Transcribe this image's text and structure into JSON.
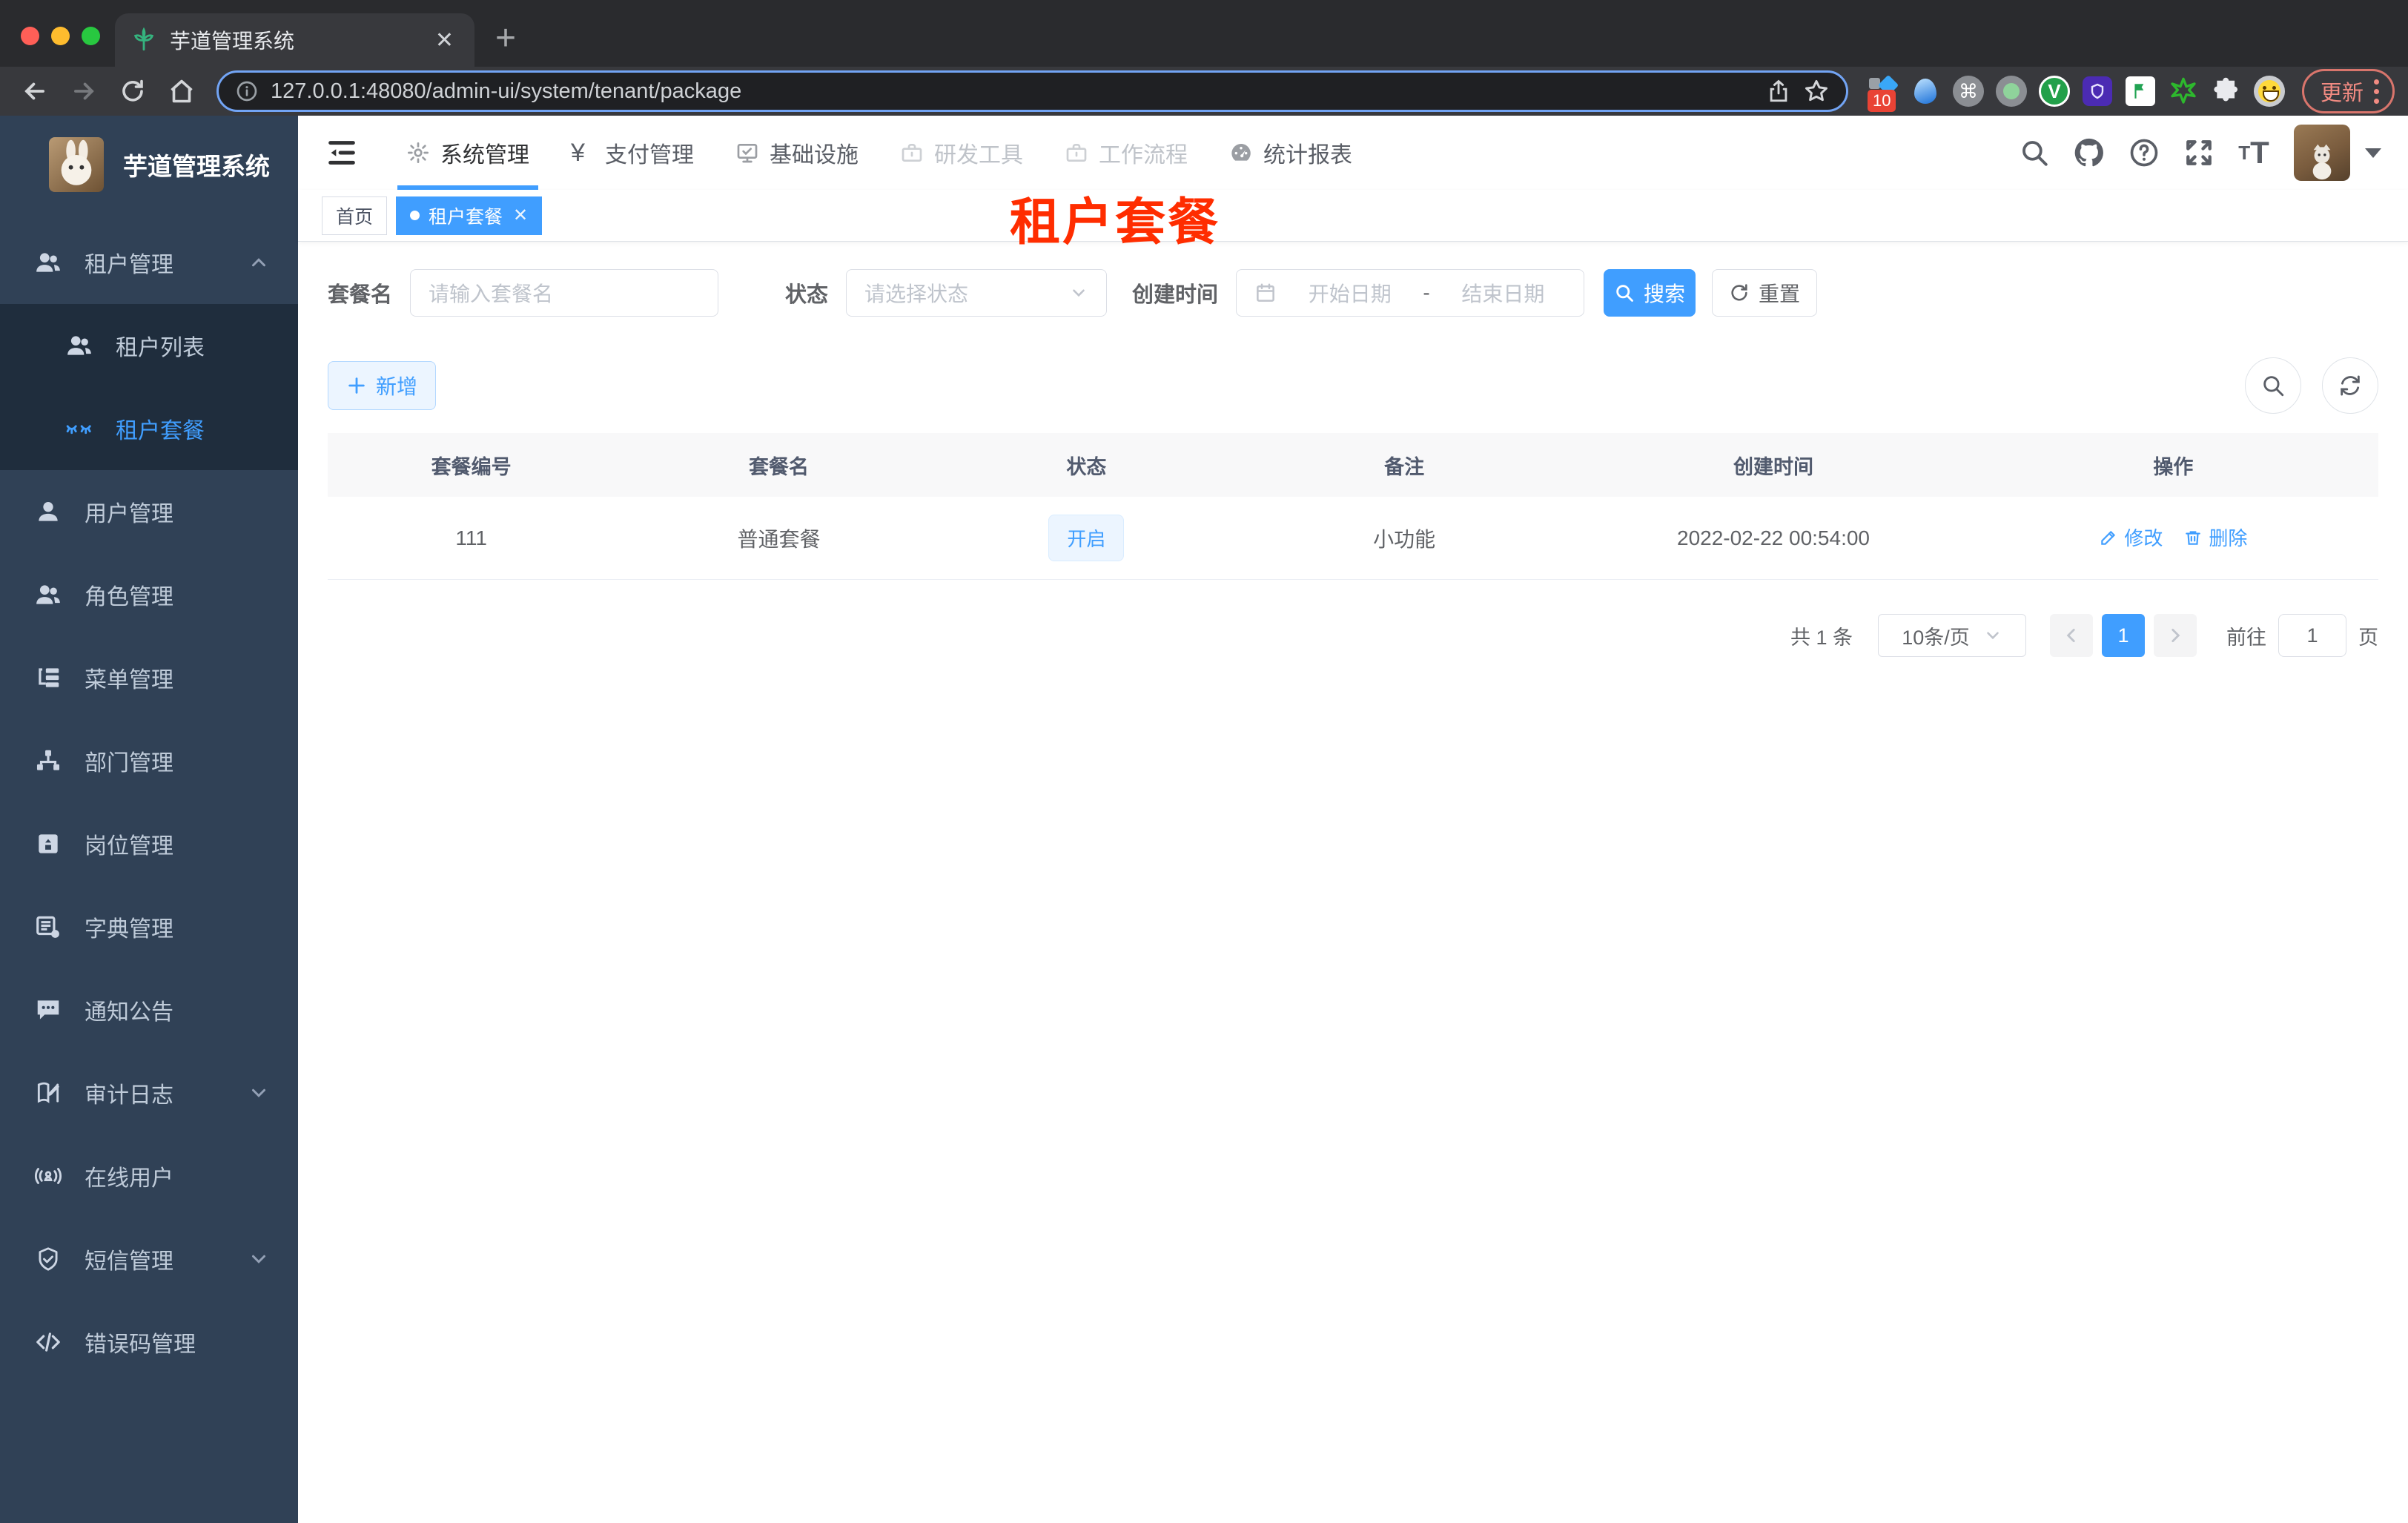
{
  "browser": {
    "tab_title": "芋道管理系统",
    "url": "127.0.0.1:48080/admin-ui/system/tenant/package",
    "ext_badge": "10",
    "update_label": "更新"
  },
  "sidebar": {
    "title": "芋道管理系统",
    "items": [
      {
        "label": "租户管理"
      },
      {
        "label": "租户列表"
      },
      {
        "label": "租户套餐"
      },
      {
        "label": "用户管理"
      },
      {
        "label": "角色管理"
      },
      {
        "label": "菜单管理"
      },
      {
        "label": "部门管理"
      },
      {
        "label": "岗位管理"
      },
      {
        "label": "字典管理"
      },
      {
        "label": "通知公告"
      },
      {
        "label": "审计日志"
      },
      {
        "label": "在线用户"
      },
      {
        "label": "短信管理"
      },
      {
        "label": "错误码管理"
      }
    ]
  },
  "topnav": {
    "items": [
      {
        "label": "系统管理"
      },
      {
        "label": "支付管理"
      },
      {
        "label": "基础设施"
      },
      {
        "label": "研发工具"
      },
      {
        "label": "工作流程"
      },
      {
        "label": "统计报表"
      }
    ]
  },
  "tags": {
    "home": "首页",
    "active": "租户套餐"
  },
  "annotation": {
    "text": "租户套餐",
    "color": "#ff2d00"
  },
  "filters": {
    "name_label": "套餐名",
    "name_placeholder": "请输入套餐名",
    "status_label": "状态",
    "status_placeholder": "请选择状态",
    "time_label": "创建时间",
    "start_placeholder": "开始日期",
    "range_separator": "-",
    "end_placeholder": "结束日期",
    "search_label": "搜索",
    "reset_label": "重置"
  },
  "toolbar": {
    "add_label": "新增"
  },
  "table": {
    "headers": [
      "套餐编号",
      "套餐名",
      "状态",
      "备注",
      "创建时间",
      "操作"
    ],
    "rows": [
      {
        "id": "111",
        "name": "普通套餐",
        "status": "开启",
        "remark": "小功能",
        "created": "2022-02-22 00:54:00",
        "edit_label": "修改",
        "delete_label": "删除"
      }
    ]
  },
  "pagination": {
    "total": "共 1 条",
    "page_size": "10条/页",
    "page": "1",
    "goto_label": "前往",
    "goto_value": "1",
    "page_unit": "页"
  },
  "colors": {
    "accent": "#409eff",
    "sidebar_bg": "#304156",
    "submenu_bg": "#1f2d3d",
    "tag_bg": "#ecf5ff",
    "annotation_red": "#ff2d00",
    "table_header_bg": "#f8f8f9"
  }
}
